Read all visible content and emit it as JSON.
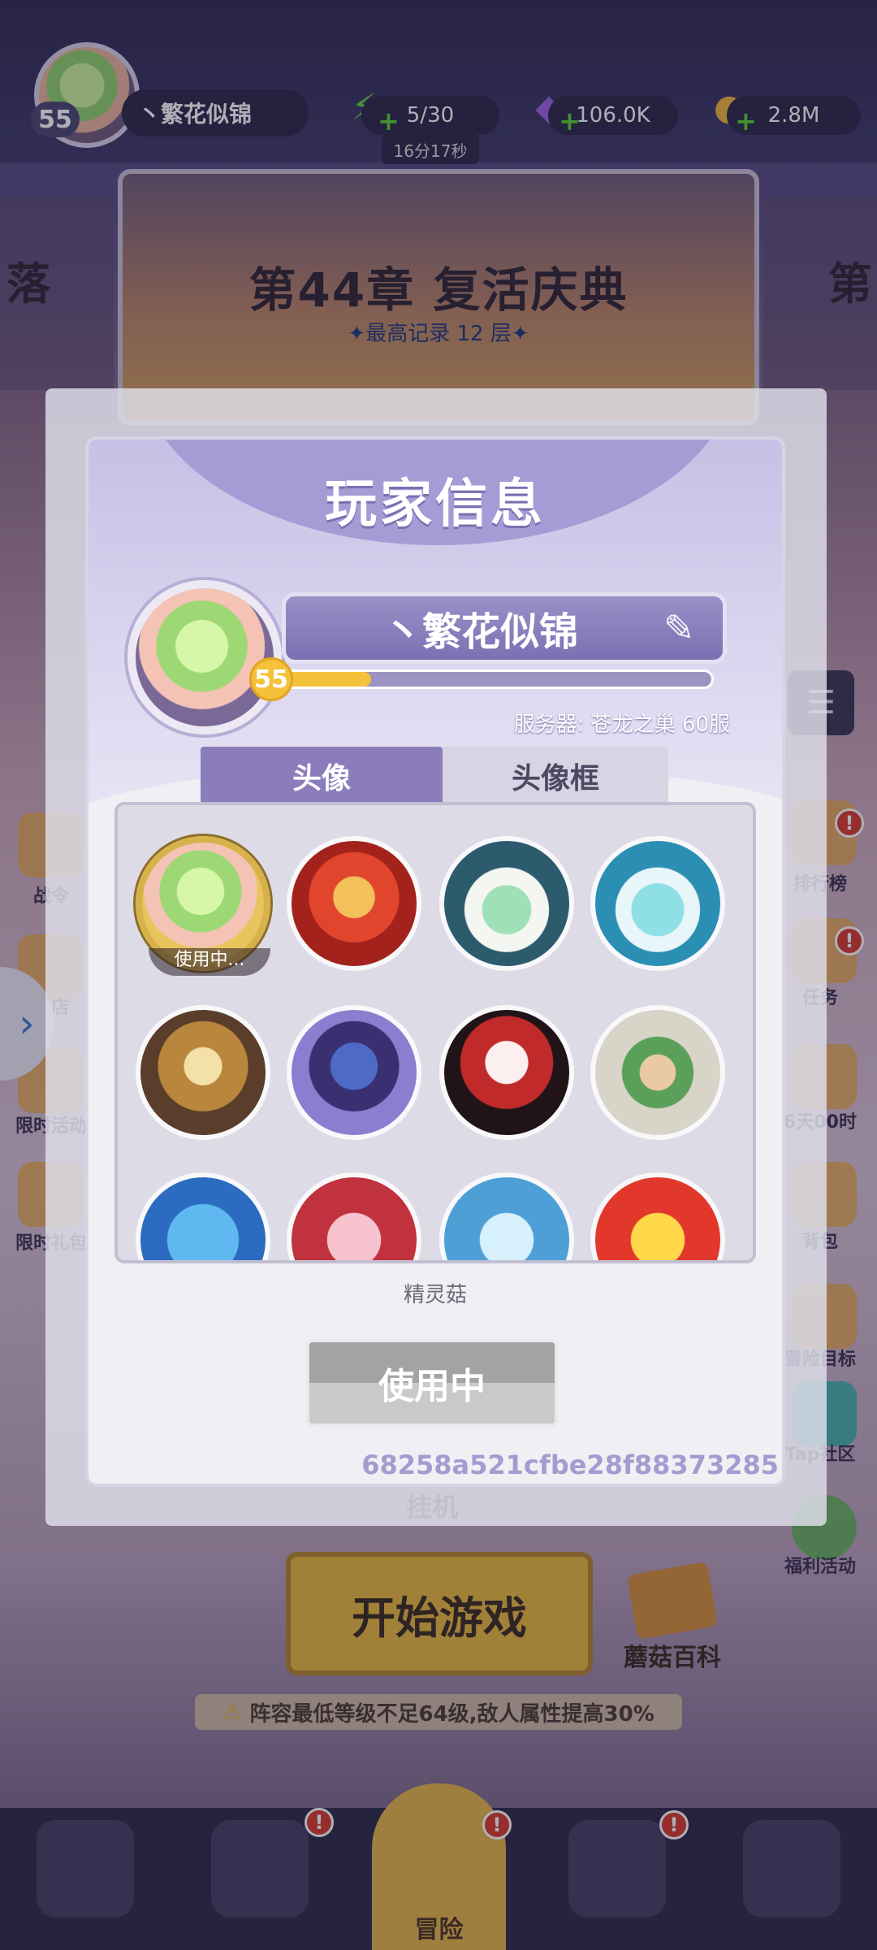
{
  "topbar": {
    "level": "55",
    "player_name": "丶繁花似锦",
    "energy": "5/30",
    "energy_timer": "16分17秒",
    "gems": "106.0K",
    "coins": "2.8M"
  },
  "chapter": {
    "title": "第44章 复活庆典",
    "record": "✦最高记录 12 层✦",
    "left_partial": "落",
    "right_partial": "第"
  },
  "left_side_menu": [
    "战令",
    "商店",
    "限时活动",
    "限时礼包"
  ],
  "right_side_menu": [
    "排行榜",
    "任务",
    "6天00时",
    "背包",
    "冒险目标",
    "Tap社区",
    "福利活动"
  ],
  "main": {
    "hang_label": "挂机",
    "start_button": "开始游戏",
    "mushroom_wiki": "蘑菇百科",
    "warning": "阵容最低等级不足64级,敌人属性提高30%"
  },
  "bottom_nav": {
    "active_label": "冒险"
  },
  "modal": {
    "title": "玩家信息",
    "player_name": "丶繁花似锦",
    "level": "55",
    "xp_progress": 0.2,
    "server": "服务器: 苍龙之巢 60服",
    "tabs": [
      "头像",
      "头像框"
    ],
    "using_tag": "使用中...",
    "selected_item_name": "精灵菇",
    "action_button": "使用中",
    "player_id": "68258a521cfbe28f88373285"
  },
  "colors": {
    "modal_accent": "#8b7dbb",
    "xp_fill": "#f4c13a",
    "start_button": "#e8b93d",
    "badge_red": "#d83a2c"
  }
}
